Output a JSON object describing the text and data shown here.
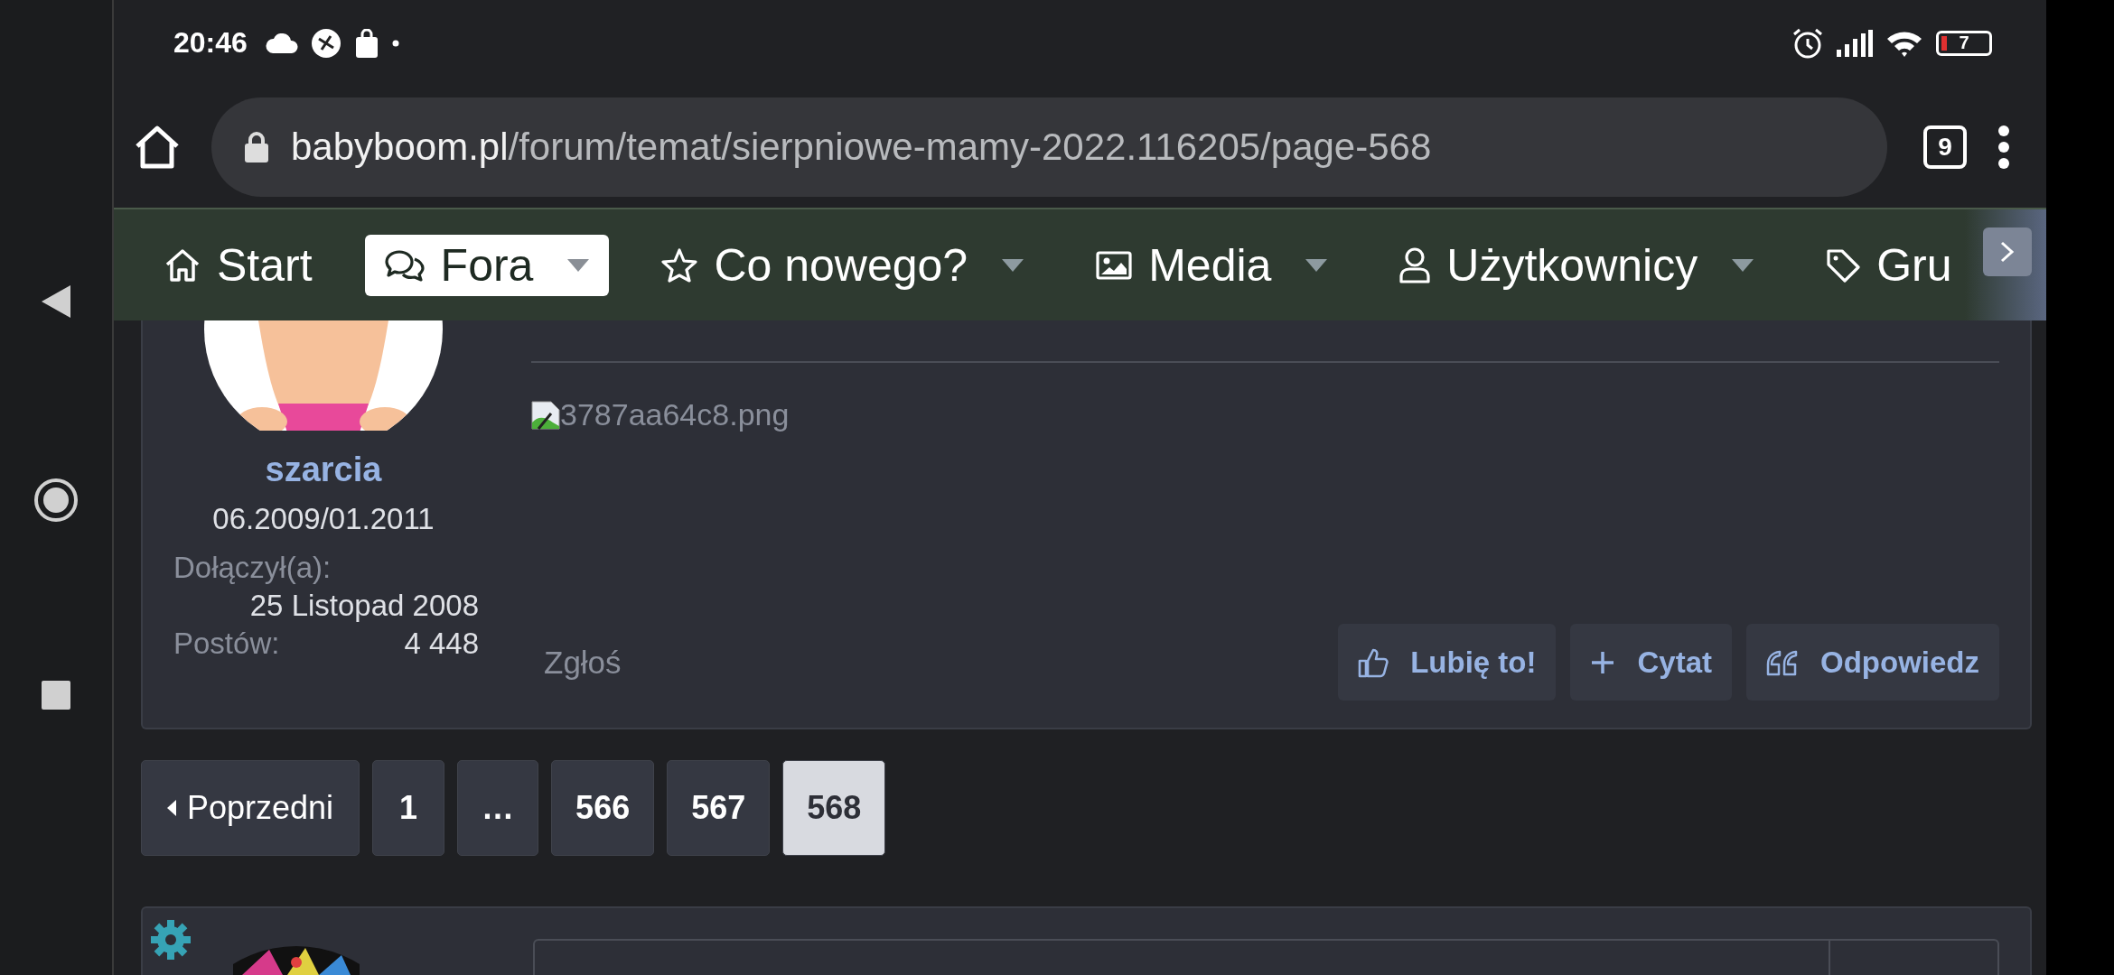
{
  "status_bar": {
    "time": "20:46",
    "battery": "7"
  },
  "browser": {
    "url_host": "babyboom.pl",
    "url_path": "/forum/temat/sierpniowe-mamy-2022.116205/page-568",
    "tab_count": "9"
  },
  "nav": {
    "items": [
      {
        "label": "Start",
        "selected": false,
        "dropdown": false
      },
      {
        "label": "Fora",
        "selected": true,
        "dropdown": true
      },
      {
        "label": "Co nowego?",
        "selected": false,
        "dropdown": true
      },
      {
        "label": "Media",
        "selected": false,
        "dropdown": true
      },
      {
        "label": "Użytkownicy",
        "selected": false,
        "dropdown": true
      },
      {
        "label": "Gru",
        "selected": false,
        "dropdown": false
      }
    ]
  },
  "post": {
    "author": "szarcia",
    "user_title": "06.2009/01.2011",
    "joined_label": "Dołączył(a):",
    "joined_value": "25 Listopad 2008",
    "posts_label": "Postów:",
    "posts_value": "4 448",
    "image_alt": "3787aa64c8.png",
    "report": "Zgłoś",
    "actions": [
      {
        "label": "Lubię to!",
        "kind": "like"
      },
      {
        "label": "Cytat",
        "kind": "quote"
      },
      {
        "label": "Odpowiedz",
        "kind": "reply"
      }
    ]
  },
  "pagination": {
    "previous": "Poprzedni",
    "pages": [
      {
        "label": "1",
        "selected": false
      },
      {
        "label": "…",
        "selected": false
      },
      {
        "label": "566",
        "selected": false
      },
      {
        "label": "567",
        "selected": false
      },
      {
        "label": "568",
        "selected": true
      }
    ]
  }
}
